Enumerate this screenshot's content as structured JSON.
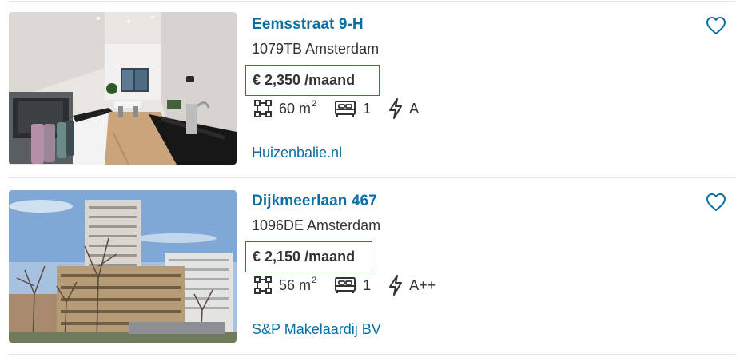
{
  "listings": [
    {
      "title": "Eemsstraat 9-H",
      "address": "1079TB Amsterdam",
      "price": "€ 2,350",
      "price_suffix": "/maand",
      "area": "60 m",
      "area_unit_sup": "2",
      "bedrooms": "1",
      "energy_label": "A",
      "agent": "Huizenbalie.nl",
      "photo": "kitchen-interior-photo"
    },
    {
      "title": "Dijkmeerlaan 467",
      "address": "1096DE Amsterdam",
      "price": "€ 2,150",
      "price_suffix": "/maand",
      "area": "56 m",
      "area_unit_sup": "2",
      "bedrooms": "1",
      "energy_label": "A++",
      "agent": "S&P Makelaardij BV",
      "photo": "apartment-building-photo"
    }
  ],
  "icons": {
    "area": "surface-area-icon",
    "bedrooms": "bed-icon",
    "energy": "lightning-icon",
    "favorite": "heart-icon"
  },
  "colors": {
    "link": "#0b6fa4",
    "price_highlight": "#c8323c",
    "text": "#333333",
    "divider": "#e4e4e4"
  }
}
